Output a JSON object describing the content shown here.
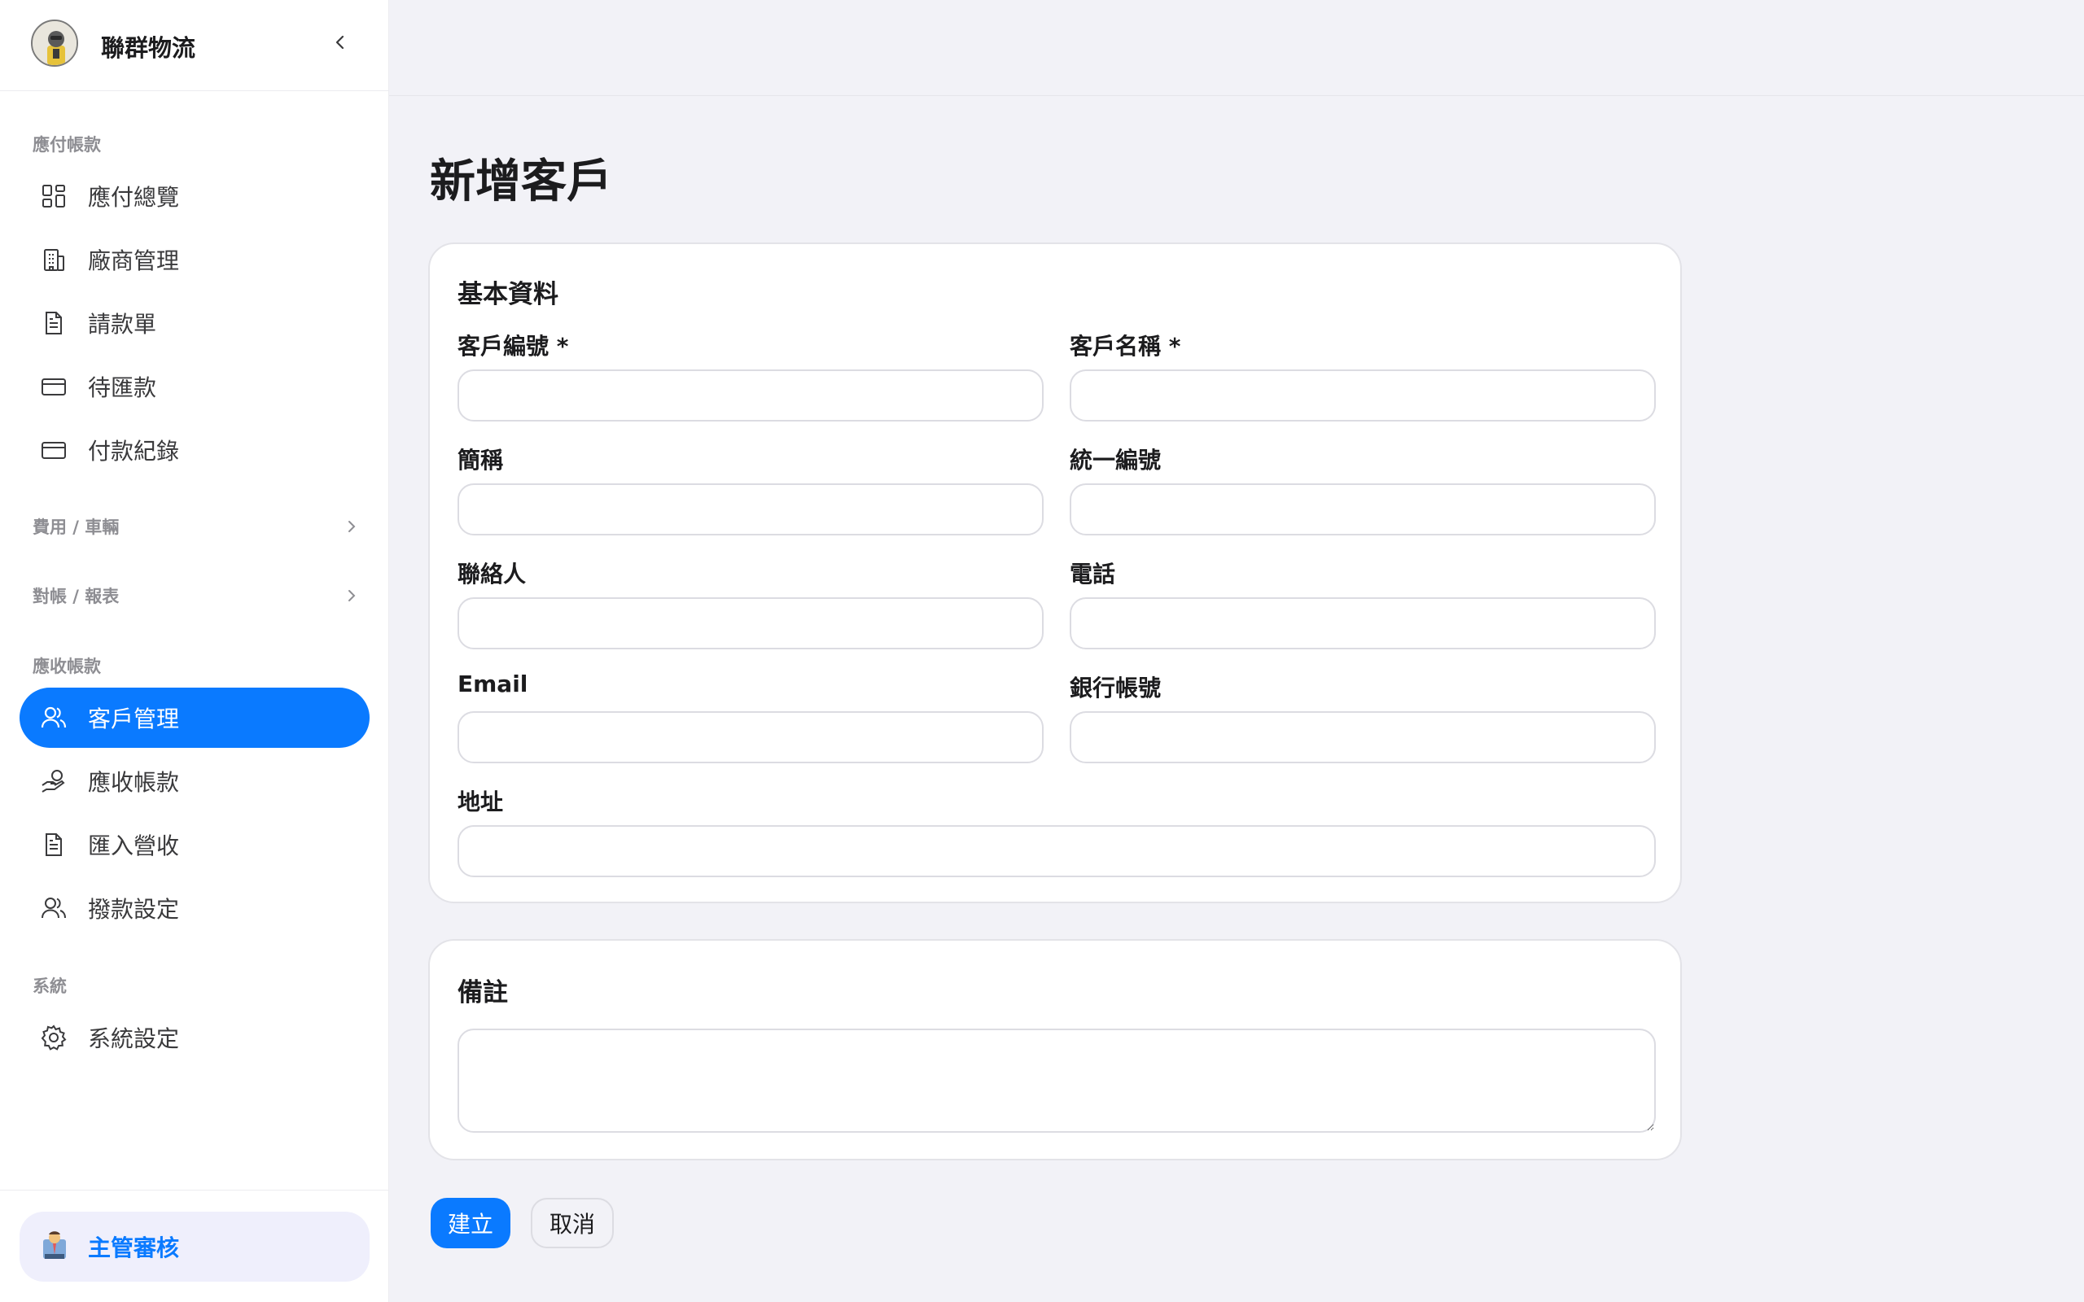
{
  "brand": {
    "name": "聯群物流"
  },
  "sidebar": {
    "sections": {
      "payable": "應付帳款",
      "receivable": "應收帳款",
      "system": "系統"
    },
    "groups": {
      "expense": "費用 / 車輛",
      "reconcile": "對帳 / 報表"
    },
    "payable_items": [
      {
        "label": "應付總覽",
        "icon": "grid-icon"
      },
      {
        "label": "廠商管理",
        "icon": "building-icon"
      },
      {
        "label": "請款單",
        "icon": "document-icon"
      },
      {
        "label": "待匯款",
        "icon": "card-icon"
      },
      {
        "label": "付款紀錄",
        "icon": "card-icon"
      }
    ],
    "receivable_items": [
      {
        "label": "客戶管理",
        "icon": "users-icon",
        "active": true
      },
      {
        "label": "應收帳款",
        "icon": "hand-coin-icon"
      },
      {
        "label": "匯入營收",
        "icon": "document-icon"
      },
      {
        "label": "撥款設定",
        "icon": "users-icon"
      }
    ],
    "system_items": [
      {
        "label": "系統設定",
        "icon": "gear-icon"
      }
    ],
    "user": {
      "label": "主管審核",
      "icon": "manager-avatar-icon"
    }
  },
  "main": {
    "title": "新增客戶",
    "basic_card": {
      "title": "基本資料",
      "fields": {
        "customer_code": {
          "label": "客戶編號 *",
          "value": ""
        },
        "customer_name": {
          "label": "客戶名稱 *",
          "value": ""
        },
        "short_name": {
          "label": "簡稱",
          "value": ""
        },
        "tax_id": {
          "label": "統一編號",
          "value": ""
        },
        "contact": {
          "label": "聯絡人",
          "value": ""
        },
        "phone": {
          "label": "電話",
          "value": ""
        },
        "email": {
          "label": "Email",
          "value": ""
        },
        "bank_account": {
          "label": "銀行帳號",
          "value": ""
        },
        "address": {
          "label": "地址",
          "value": ""
        }
      }
    },
    "notes_card": {
      "title": "備註",
      "value": ""
    },
    "actions": {
      "create": "建立",
      "cancel": "取消"
    }
  },
  "colors": {
    "accent": "#0a7aff",
    "background": "#f2f2f7",
    "user_card_bg": "#efeffc"
  }
}
